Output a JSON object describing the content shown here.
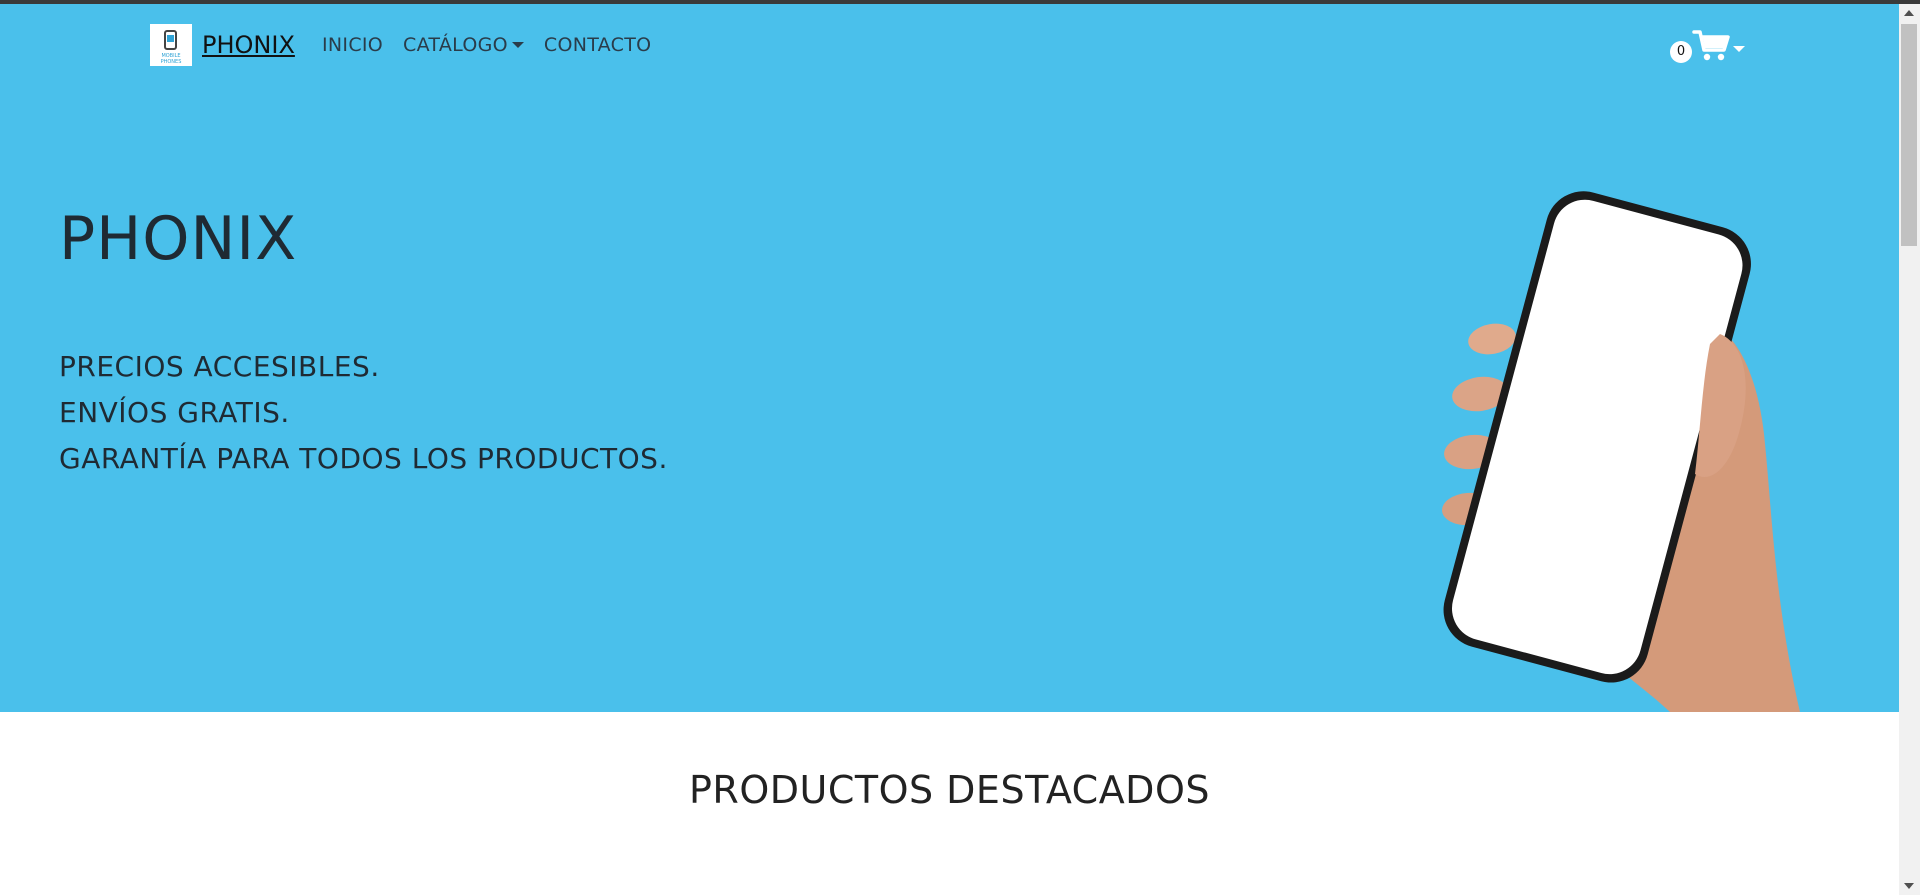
{
  "brand": {
    "name": "PHONIX",
    "logo_text": "MOBILE PHONES"
  },
  "nav": {
    "items": [
      {
        "label": "INICIO"
      },
      {
        "label": "CATÁLOGO"
      },
      {
        "label": "CONTACTO"
      }
    ]
  },
  "cart": {
    "count": "0",
    "icon": "cart-icon"
  },
  "hero": {
    "title": "PHONIX",
    "lines": [
      "PRECIOS ACCESIBLES.",
      "ENVÍOS GRATIS.",
      "GARANTÍA PARA TODOS LOS PRODUCTOS."
    ],
    "background_color": "#4ac0eb"
  },
  "featured": {
    "title": "PRODUCTOS DESTACADOS"
  }
}
